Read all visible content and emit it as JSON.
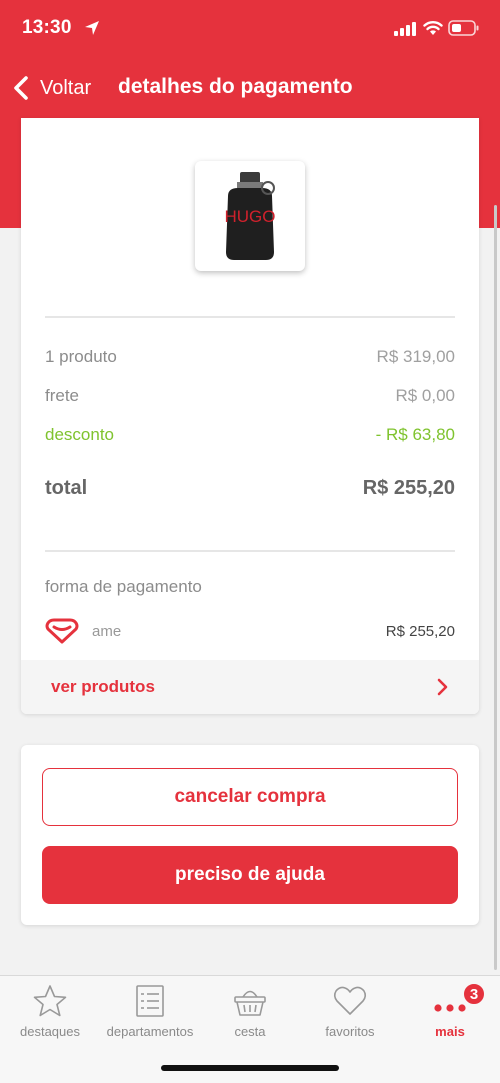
{
  "status_bar": {
    "time": "13:30"
  },
  "nav": {
    "back_label": "Voltar",
    "title": "detalhes do pagamento"
  },
  "product": {
    "brand_text": "HUGO"
  },
  "summary": {
    "items": [
      {
        "label": "1 produto",
        "value": "R$ 319,00"
      },
      {
        "label": "frete",
        "value": "R$ 0,00"
      },
      {
        "label": "desconto",
        "value": "- R$ 63,80"
      }
    ],
    "total": {
      "label": "total",
      "value": "R$ 255,20"
    }
  },
  "payment": {
    "section_label": "forma de pagamento",
    "method": "ame",
    "amount": "R$ 255,20"
  },
  "see_products_label": "ver produtos",
  "actions": {
    "cancel_label": "cancelar compra",
    "help_label": "preciso de ajuda"
  },
  "tabs": [
    {
      "label": "destaques",
      "icon": "star-icon"
    },
    {
      "label": "departamentos",
      "icon": "list-icon"
    },
    {
      "label": "cesta",
      "icon": "basket-icon"
    },
    {
      "label": "favoritos",
      "icon": "heart-icon"
    },
    {
      "label": "mais",
      "icon": "more-dots-icon",
      "badge": "3",
      "active": true
    }
  ],
  "colors": {
    "brand_red": "#e5323d",
    "discount_green": "#7fc32e",
    "text_gray": "#666666"
  }
}
